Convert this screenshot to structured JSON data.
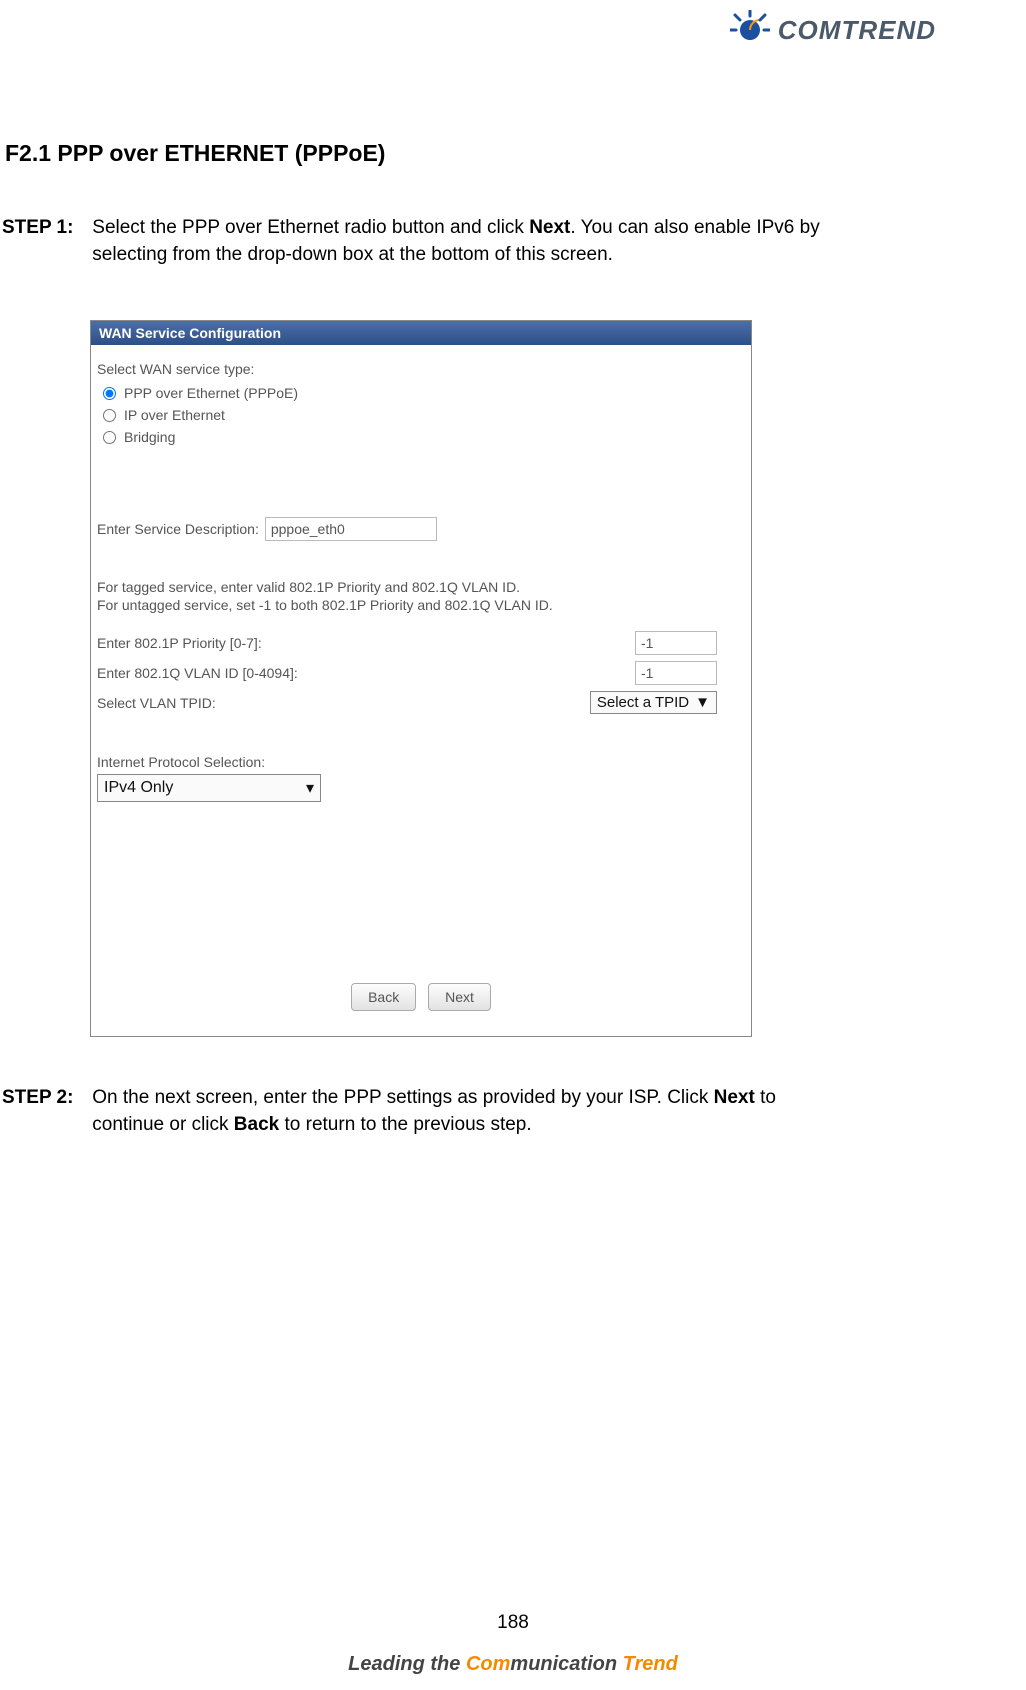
{
  "brand": {
    "name": "COMTREND"
  },
  "heading": "F2.1 PPP over ETHERNET (PPPoE)",
  "steps": {
    "s1": {
      "label": "STEP 1:",
      "text_a": "Select the PPP over Ethernet radio button and click ",
      "next": "Next",
      "text_b": ". You can also enable IPv6 by selecting from the drop-down box at the bottom of this screen."
    },
    "s2": {
      "label": "STEP 2:",
      "text_a": "On the next screen, enter the PPP settings as provided by your ISP. Click ",
      "next": "Next",
      "text_b": " to continue or click ",
      "back": "Back",
      "text_c": " to return to the previous step."
    }
  },
  "panel": {
    "title": "WAN Service Configuration",
    "select_wan_label": "Select WAN service type:",
    "radios": {
      "pppoe": "PPP over Ethernet (PPPoE)",
      "ipoe": "IP over Ethernet",
      "bridge": "Bridging"
    },
    "svc_desc_label": "Enter Service Description:",
    "svc_desc_value": "pppoe_eth0",
    "hint1": "For tagged service, enter valid 802.1P Priority and 802.1Q VLAN ID.",
    "hint2": "For untagged service, set -1 to both 802.1P Priority and 802.1Q VLAN ID.",
    "p8021p_label": "Enter 802.1P Priority [0-7]:",
    "p8021p_value": "-1",
    "q8021q_label": "Enter 802.1Q VLAN ID [0-4094]:",
    "q8021q_value": "-1",
    "tpid_label": "Select VLAN TPID:",
    "tpid_value": "Select a TPID",
    "ipsel_label": "Internet Protocol Selection:",
    "ipsel_value": "IPv4 Only",
    "back_btn": "Back",
    "next_btn": "Next"
  },
  "page_number": "188",
  "footer": {
    "a": "Leading the ",
    "b": "Com",
    "c": "munication ",
    "d": "Trend"
  }
}
